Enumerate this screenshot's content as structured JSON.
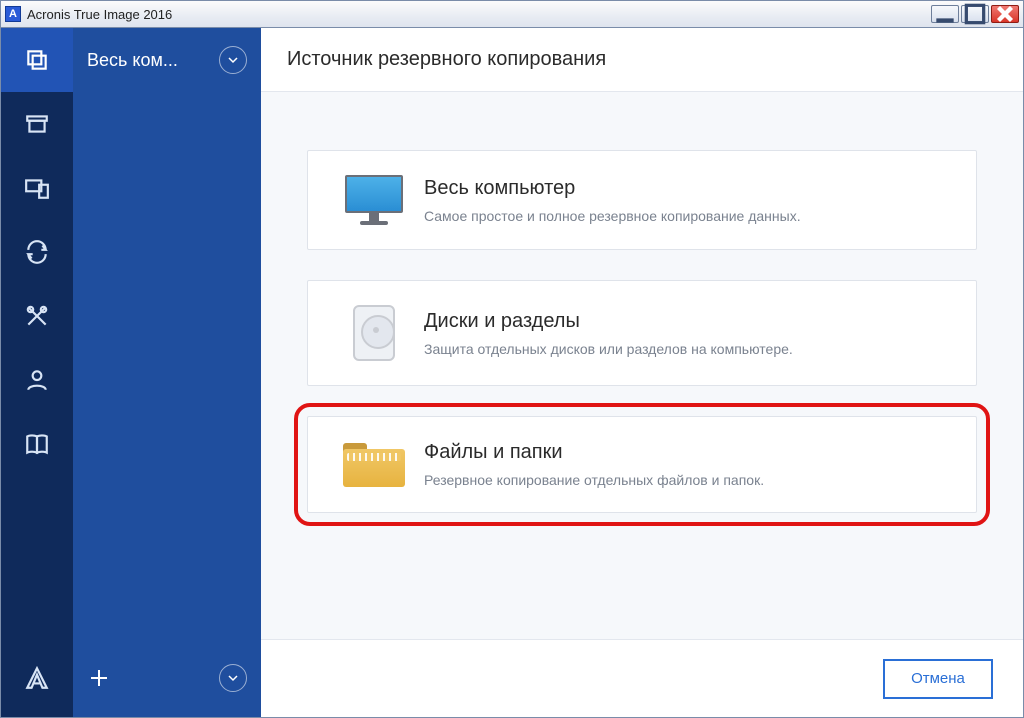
{
  "window": {
    "title": "Acronis True Image 2016"
  },
  "side_panel": {
    "head_label": "Весь ком..."
  },
  "main": {
    "header": "Источник резервного копирования",
    "options": [
      {
        "title": "Весь компьютер",
        "desc": "Самое простое и полное резервное копирование данных."
      },
      {
        "title": "Диски и разделы",
        "desc": "Защита отдельных дисков или разделов на компьютере."
      },
      {
        "title": "Файлы и папки",
        "desc": "Резервное копирование отдельных файлов и папок."
      }
    ],
    "cancel": "Отмена"
  }
}
